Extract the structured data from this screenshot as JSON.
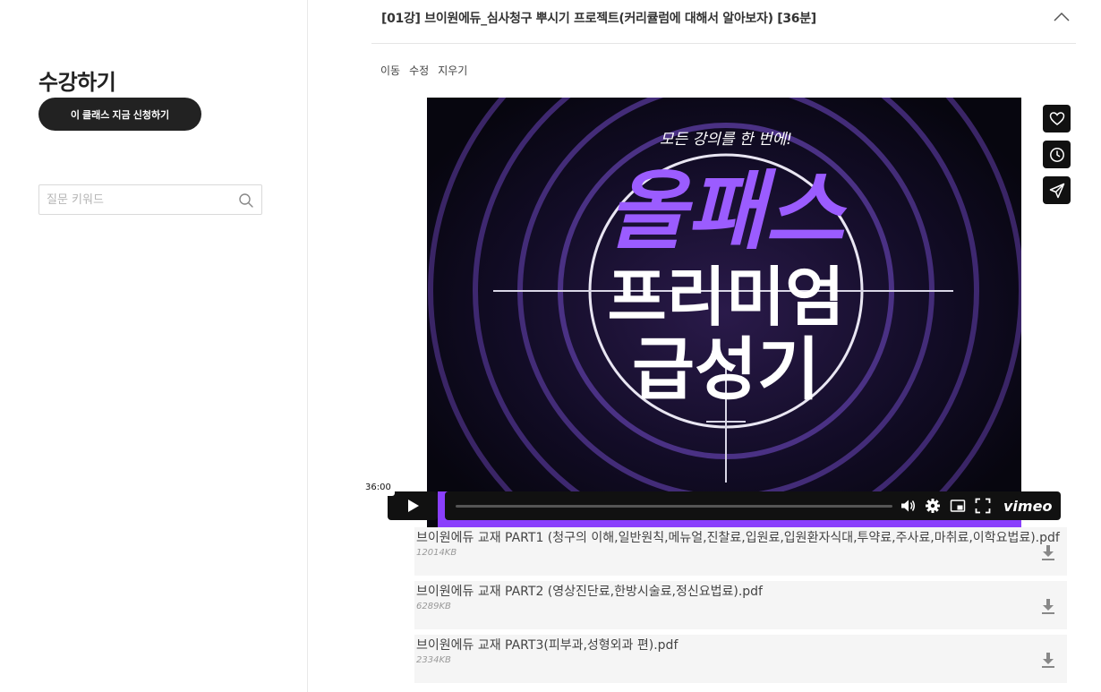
{
  "sidebar": {
    "title": "수강하기",
    "enroll_label": "이 클래스 지금 신청하기",
    "search_placeholder": "질문 키워드"
  },
  "lesson": {
    "title": "[01강] 브이원에듀_심사청구 뿌시기 프로젝트(커리큘럼에 대해서 알아보자) [36분]",
    "actions": [
      "이동",
      "수정",
      "지우기"
    ]
  },
  "video": {
    "poster_tagline": "모든 강의를 한 번에!",
    "poster_line1": "올패스",
    "poster_line2": "프리미엄",
    "poster_line3": "급성기",
    "time_tooltip": "36:00",
    "brand": "vimeo",
    "accent_color": "#8a3ffc",
    "side_tools": [
      "heart-icon",
      "clock-icon",
      "send-icon"
    ]
  },
  "files": [
    {
      "name": "브이원에듀 교재 PART1 (청구의 이해,일반원칙,메뉴얼,진찰료,입원료,입원환자식대,투약료,주사료,마취료,이학요법료).pdf",
      "size": "12014KB"
    },
    {
      "name": "브이원에듀 교재 PART2 (영상진단료,한방시술료,정신요법료).pdf",
      "size": "6289KB"
    },
    {
      "name": "브이원에듀 교재 PART3(피부과,성형외과 편).pdf",
      "size": "2334KB"
    }
  ]
}
